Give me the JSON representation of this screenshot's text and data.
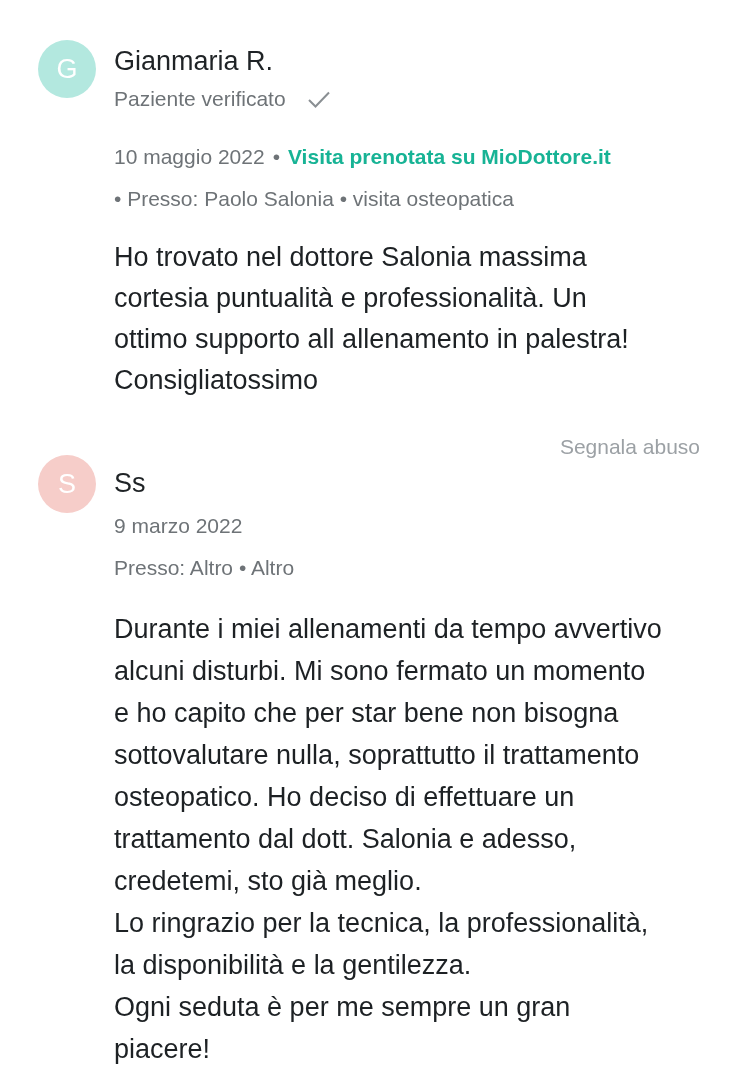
{
  "reviews": [
    {
      "avatar": {
        "letter": "G",
        "color": "#b3e8df"
      },
      "author": "Gianmaria R.",
      "verified": {
        "label": "Paziente verificato"
      },
      "date": "10 maggio 2022",
      "booking": {
        "separator": "•",
        "label": "Visita prenotata su MioDottore.it"
      },
      "details": "• Presso: Paolo Salonia • visita osteopatica",
      "text": "Ho trovato nel dottore Salonia massima cortesia puntualità e professionalità. Un ottimo supporto all allenamento in palestra! Consigliatossimo",
      "report_link": "Segnala abuso"
    },
    {
      "avatar": {
        "letter": "S",
        "color": "#f6cdc9"
      },
      "author": "Ss",
      "date": "9 marzo 2022",
      "details": "Presso: Altro • Altro",
      "text": "Durante i miei allenamenti da tempo avvertivo alcuni disturbi. Mi sono fermato un momento e ho capito che per star bene non bisogna sottovalutare nulla, soprattutto il trattamento osteopatico. Ho deciso di effettuare un trattamento dal dott. Salonia e adesso, credetemi, sto già meglio.\nLo ringrazio per la tecnica, la professionalità, la disponibilità e la gentilezza.\nOgni seduta è per me sempre un gran piacere!"
    }
  ]
}
